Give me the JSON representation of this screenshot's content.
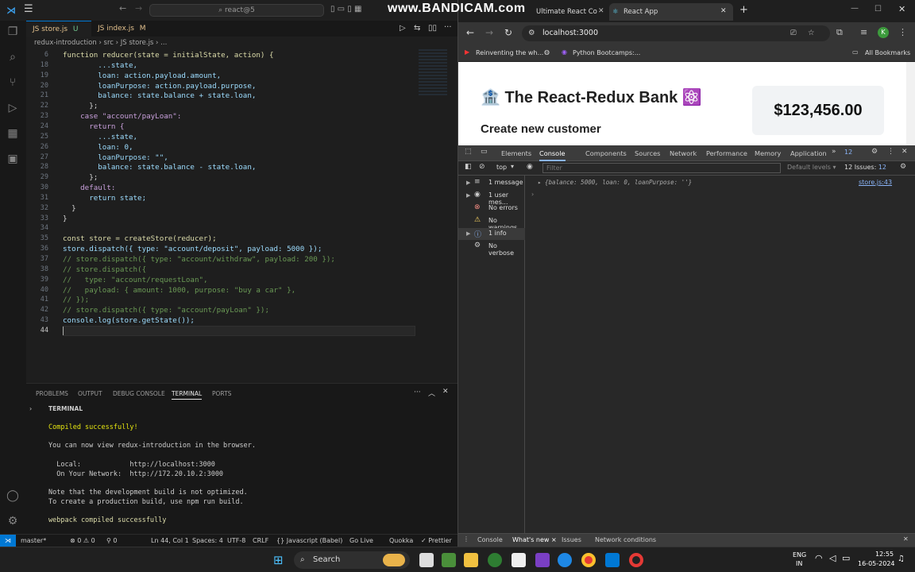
{
  "watermark": "www.BANDICAM.com",
  "vscode": {
    "search": "⌕ react@5",
    "tabs": [
      {
        "label": "JS store.js",
        "flag": "U"
      },
      {
        "label": "JS index.js",
        "flag": "M"
      }
    ],
    "breadcrumb": "redux-introduction  ›  src  ›  JS store.js  ›  ...",
    "lines": [
      {
        "n": "6",
        "t": "function reducer(state = initialState, action) {"
      },
      {
        "n": "18",
        "t": "        ...state,"
      },
      {
        "n": "19",
        "t": "        loan: action.payload.amount,"
      },
      {
        "n": "20",
        "t": "        loanPurpose: action.payload.purpose,"
      },
      {
        "n": "21",
        "t": "        balance: state.balance + state.loan,"
      },
      {
        "n": "22",
        "t": "      };"
      },
      {
        "n": "23",
        "t": "    case \"account/payLoan\":"
      },
      {
        "n": "24",
        "t": "      return {"
      },
      {
        "n": "25",
        "t": "        ...state,"
      },
      {
        "n": "26",
        "t": "        loan: 0,"
      },
      {
        "n": "27",
        "t": "        loanPurpose: \"\","
      },
      {
        "n": "28",
        "t": "        balance: state.balance - state.loan,"
      },
      {
        "n": "29",
        "t": "      };"
      },
      {
        "n": "30",
        "t": "    default:"
      },
      {
        "n": "31",
        "t": "      return state;"
      },
      {
        "n": "32",
        "t": "  }"
      },
      {
        "n": "33",
        "t": "}"
      },
      {
        "n": "34",
        "t": ""
      },
      {
        "n": "35",
        "t": "const store = createStore(reducer);"
      },
      {
        "n": "36",
        "t": "store.dispatch({ type: \"account/deposit\", payload: 5000 });"
      },
      {
        "n": "37",
        "t": "// store.dispatch({ type: \"account/withdraw\", payload: 200 });"
      },
      {
        "n": "38",
        "t": "// store.dispatch({"
      },
      {
        "n": "39",
        "t": "//   type: \"account/requestLoan\","
      },
      {
        "n": "40",
        "t": "//   payload: { amount: 1000, purpose: \"buy a car\" },"
      },
      {
        "n": "41",
        "t": "// });"
      },
      {
        "n": "42",
        "t": "// store.dispatch({ type: \"account/payLoan\" });"
      },
      {
        "n": "43",
        "t": "console.log(store.getState());"
      },
      {
        "n": "44",
        "t": ""
      }
    ],
    "panel_tabs": [
      "PROBLEMS",
      "OUTPUT",
      "DEBUG CONSOLE",
      "TERMINAL",
      "PORTS"
    ],
    "terminal_header": "TERMINAL",
    "terminal": [
      "Compiled successfully!",
      "",
      "You can now view redux-introduction in the browser.",
      "",
      "  Local:            http://localhost:3000",
      "  On Your Network:  http://172.20.10.2:3000",
      "",
      "Note that the development build is not optimized.",
      "To create a production build, use npm run build.",
      "",
      "webpack compiled successfully"
    ],
    "status": {
      "branch": "master*",
      "errors": "⊗ 0 ⚠ 0",
      "ports": "⚲ 0",
      "pos": "Ln 44, Col 1",
      "spaces": "Spaces: 4",
      "enc": "UTF-8",
      "eol": "CRLF",
      "lang": "{} Javascript (Babel)",
      "live": "Go Live",
      "quokka": "Quokka",
      "prettier": "✓ Prettier"
    }
  },
  "chrome": {
    "tabs": [
      {
        "label": "Ultimate React Co"
      },
      {
        "label": "React App"
      }
    ],
    "url": "localhost:3000",
    "bookmarks": [
      "Reinventing the wh...",
      "Python Bootcamps:..."
    ],
    "all_bookmarks": "All Bookmarks",
    "page": {
      "title": "🏦 The React-Redux Bank ⚛️",
      "subtitle": "Create new customer",
      "balance": "$123,456.00"
    },
    "devtools": {
      "tabs": [
        "Elements",
        "Console",
        "Components",
        "Sources",
        "Network",
        "Performance",
        "Memory",
        "Application"
      ],
      "issue_count": "12",
      "context": "top",
      "filter_placeholder": "Filter",
      "levels": "Default levels ▾",
      "issues": "12 Issues: ",
      "issues_count": "12",
      "sidebar": [
        "1 message",
        "1 user mes...",
        "No errors",
        "No warnings",
        "1 info",
        "No verbose"
      ],
      "log": "{balance: 5000, loan: 0, loanPurpose: ''}",
      "log_source": "store.js:43",
      "drawer": [
        "Console",
        "What's new ×",
        "Issues",
        "Network conditions"
      ]
    }
  },
  "taskbar": {
    "search": "Search",
    "lang1": "ENG",
    "lang2": "IN",
    "time": "12:55",
    "date": "16-05-2024"
  }
}
